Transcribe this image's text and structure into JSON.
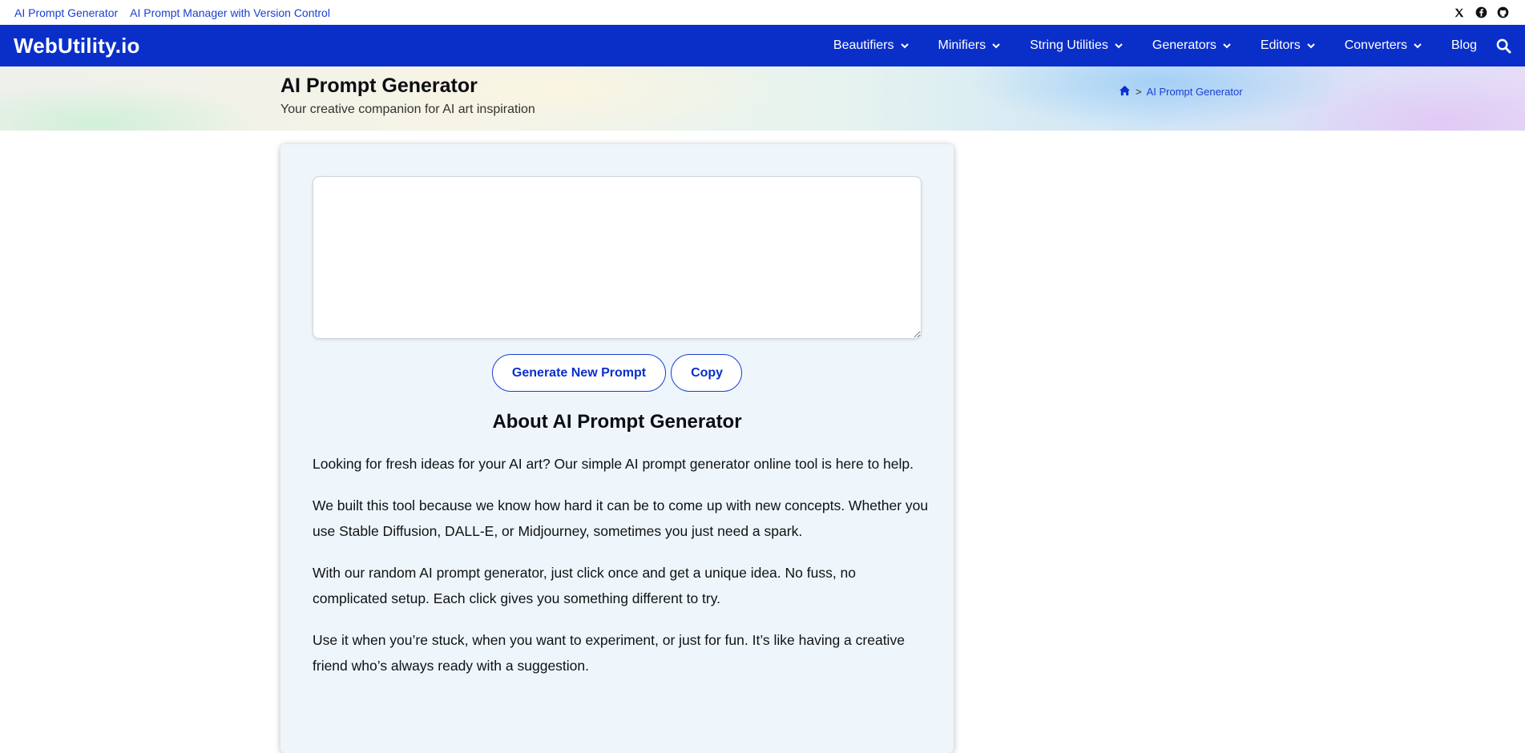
{
  "topbar": {
    "links": [
      "AI Prompt Generator",
      "AI Prompt Manager with Version Control"
    ],
    "social": [
      "x-icon",
      "facebook-icon",
      "github-icon"
    ]
  },
  "nav": {
    "logo": "WebUtility.io",
    "items": [
      "Beautifiers",
      "Minifiers",
      "String Utilities",
      "Generators",
      "Editors",
      "Converters"
    ],
    "blog": "Blog"
  },
  "hero": {
    "title": "AI Prompt Generator",
    "subtitle": "Your creative companion for AI art inspiration",
    "breadcrumb": "AI Prompt Generator"
  },
  "tool": {
    "prompt_value": "",
    "generate_label": "Generate New Prompt",
    "copy_label": "Copy"
  },
  "about": {
    "title": "About AI Prompt Generator",
    "paragraphs": [
      "Looking for fresh ideas for your AI art? Our simple AI prompt generator online tool is here to help.",
      "We built this tool because we know how hard it can be to come up with new concepts. Whether you use Stable Diffusion, DALL-E, or Midjourney, sometimes you just need a spark.",
      "With our random AI prompt generator, just click once and get a unique idea. No fuss, no complicated setup. Each click gives you something different to try.",
      "Use it when you’re stuck, when you want to experiment, or just for fun. It’s like having a creative friend who’s always ready with a suggestion."
    ]
  },
  "colors": {
    "brand": "#0a2fc9",
    "link": "#1a3fd1",
    "card_bg": "#eef6fc"
  }
}
